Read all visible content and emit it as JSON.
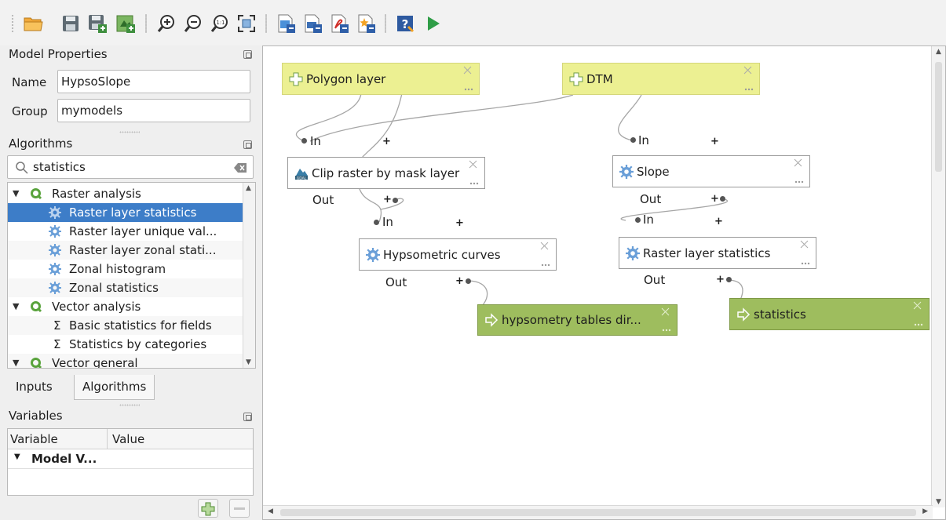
{
  "toolbar": {
    "buttons": [
      "open-model-icon",
      "save-model-icon",
      "save-as-icon",
      "save-to-project-icon",
      "zoom-in-icon",
      "zoom-out-icon",
      "zoom-actual-icon",
      "zoom-full-icon",
      "export-image-icon",
      "export-svg-icon",
      "export-pdf-icon",
      "export-python-icon",
      "edit-help-icon",
      "run-model-icon"
    ]
  },
  "model_properties": {
    "title": "Model Properties",
    "name_label": "Name",
    "name_value": "HypsoSlope",
    "group_label": "Group",
    "group_value": "mymodels"
  },
  "algorithms": {
    "title": "Algorithms",
    "search_value": "statistics",
    "tree": [
      {
        "label": "Raster analysis",
        "kind": "group"
      },
      {
        "label": "Raster layer statistics",
        "kind": "alg",
        "selected": true
      },
      {
        "label": "Raster layer unique val...",
        "kind": "alg"
      },
      {
        "label": "Raster layer zonal stati...",
        "kind": "alg"
      },
      {
        "label": "Zonal histogram",
        "kind": "alg"
      },
      {
        "label": "Zonal statistics",
        "kind": "alg"
      },
      {
        "label": "Vector analysis",
        "kind": "group"
      },
      {
        "label": "Basic statistics for fields",
        "kind": "sum"
      },
      {
        "label": "Statistics by categories",
        "kind": "sum"
      },
      {
        "label": "Vector general",
        "kind": "group"
      }
    ]
  },
  "tabs": {
    "inputs": "Inputs",
    "algorithms": "Algorithms"
  },
  "variables": {
    "title": "Variables",
    "col_variable": "Variable",
    "col_value": "Value",
    "row_model": "Model V..."
  },
  "canvas": {
    "nodes": {
      "polygon": "Polygon layer",
      "dtm": "DTM",
      "clip": "Clip raster by mask layer",
      "slope": "Slope",
      "hypso": "Hypsometric curves",
      "rls": "Raster layer statistics",
      "out_hypso": "hypsometry tables dir...",
      "out_stats": "statistics"
    },
    "port_in": "In",
    "port_out": "Out",
    "plus": "+"
  },
  "colors": {
    "input_node": "#ecf092",
    "output_node": "#9ebd5e",
    "selection": "#3d7dc8"
  }
}
